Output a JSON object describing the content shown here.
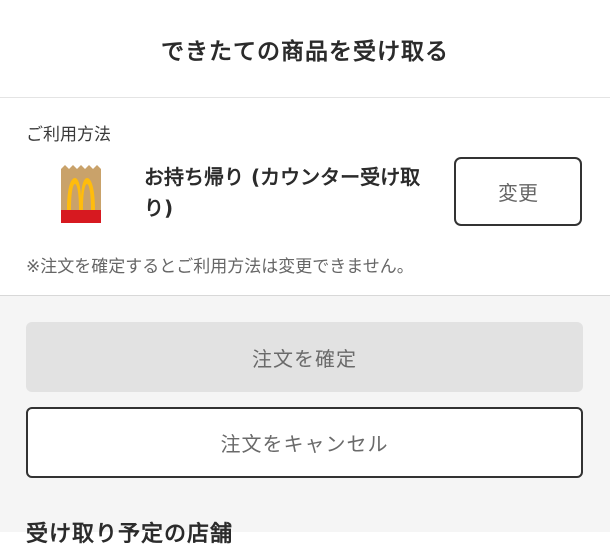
{
  "header": {
    "title": "できたての商品を受け取る"
  },
  "usage": {
    "label": "ご利用方法",
    "method_icon": "takeout-bag-icon",
    "method": "お持ち帰り (カウンター受け取り)",
    "change_label": "変更",
    "note": "※注文を確定するとご利用方法は変更できません。"
  },
  "actions": {
    "confirm_label": "注文を確定",
    "cancel_label": "注文をキャンセル"
  },
  "store_section": {
    "title": "受け取り予定の店舗"
  },
  "colors": {
    "bag_paper": "#c9a26a",
    "bag_red": "#d71920",
    "logo_yellow": "#ffbc0d",
    "disabled_button": "#e2e2e2",
    "page_bg": "#f5f5f5"
  }
}
